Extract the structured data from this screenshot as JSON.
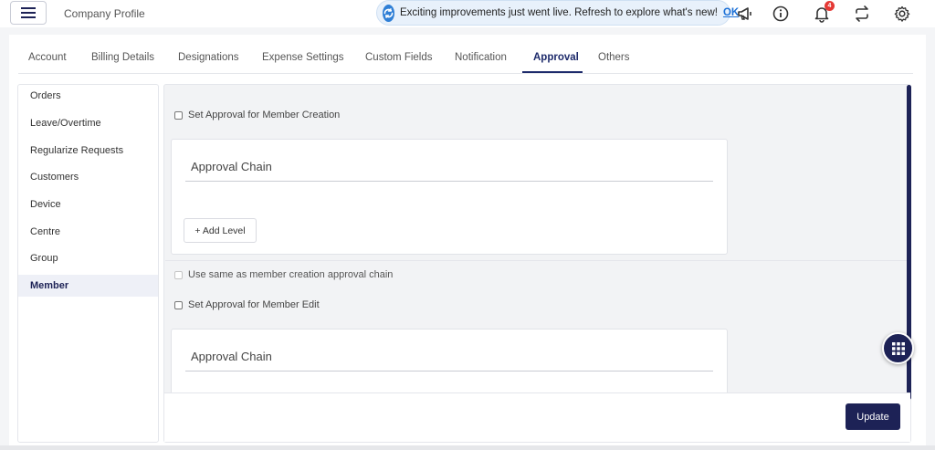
{
  "header": {
    "title": "Company Profile",
    "announcement": "Exciting improvements just went live. Refresh to explore what's new!",
    "announcement_action": "OK",
    "notification_count": "4",
    "icons": [
      "menu-icon",
      "sync-icon",
      "megaphone-icon",
      "info-icon",
      "bell-icon",
      "switch-icon",
      "gear-icon"
    ]
  },
  "tabs": [
    {
      "label": "Account"
    },
    {
      "label": "Billing Details"
    },
    {
      "label": "Designations"
    },
    {
      "label": "Expense Settings"
    },
    {
      "label": "Custom Fields"
    },
    {
      "label": "Notification"
    },
    {
      "label": "Approval"
    },
    {
      "label": "Others"
    }
  ],
  "active_tab": "Approval",
  "sidebar": {
    "items": [
      {
        "label": "Orders"
      },
      {
        "label": "Leave/Overtime"
      },
      {
        "label": "Regularize Requests"
      },
      {
        "label": "Customers"
      },
      {
        "label": "Device"
      },
      {
        "label": "Centre"
      },
      {
        "label": "Group"
      },
      {
        "label": "Member"
      }
    ],
    "active": "Member"
  },
  "main": {
    "creation_checkbox_label": "Set Approval for Member Creation",
    "chain1_title": "Approval Chain",
    "add_level_label": "+ Add Level",
    "same_chain_label": "Use same as member creation approval chain",
    "edit_checkbox_label": "Set Approval for Member Edit",
    "chain2_title": "Approval Chain",
    "update_label": "Update"
  },
  "colors": {
    "primary": "#1d2256",
    "badge": "#e53935",
    "link": "#1a6fd6"
  }
}
